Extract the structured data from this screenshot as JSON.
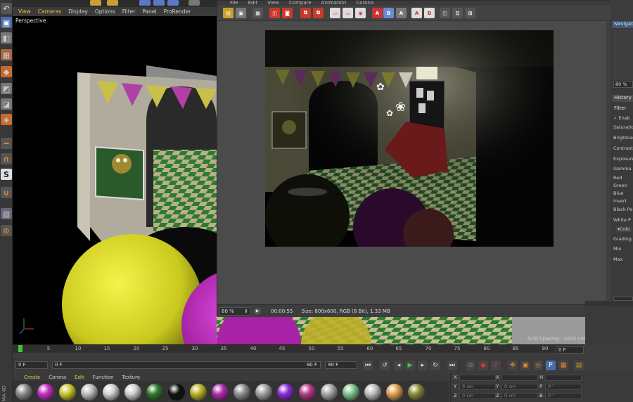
{
  "viewport": {
    "menu": [
      "View",
      "Cameras",
      "Display",
      "Options",
      "Filter",
      "Panel",
      "ProRender"
    ],
    "camera_label": "Perspective",
    "grid_spacing": "Grid Spacing : 1000 cm"
  },
  "picture_viewer": {
    "menu": [
      "File",
      "Edit",
      "View",
      "Compare",
      "Animation",
      "Corona"
    ],
    "zoom": "80 %",
    "render_time": "00:00:55",
    "image_info": "Size: 800x600, RGB (8 Bit), 1.33 MB"
  },
  "right_panel": {
    "navigator_tab": "Navigator",
    "zoom_value": "80 %",
    "history_tab": "History",
    "filter_tab": "Filter",
    "enable_label": "Enab",
    "rows": [
      "Saturation",
      "Brightne",
      "Contrast",
      "Exposure",
      "Gamma",
      "Red",
      "Green",
      "Blue",
      "Invert",
      "Black Po",
      "White P"
    ],
    "color_section": "Colo",
    "bottom_rows": [
      "Grading",
      "Min",
      "Max"
    ]
  },
  "timeline": {
    "ticks": [
      "0",
      "5",
      "10",
      "15",
      "20",
      "25",
      "30",
      "35",
      "40",
      "45",
      "50",
      "55",
      "60",
      "65",
      "70",
      "75",
      "80",
      "85",
      "90"
    ],
    "current_frame": "0 F"
  },
  "controls": {
    "start_field": "0 F",
    "range_start": "0 F",
    "range_end": "90 F",
    "end_field": "90 F"
  },
  "materials": {
    "menu": [
      "Create",
      "Corona",
      "Edit",
      "Function",
      "Texture"
    ],
    "swatches": [
      "#8a8a8a",
      "#c22ec2",
      "#c8c82a",
      "#bdbdbd",
      "#d0d0d0",
      "#cfcfcf",
      "#2e7a2e",
      "#111111",
      "#bcb22a",
      "#b02cae",
      "#8e8e8e",
      "#a0a0a0",
      "#8a2cd8",
      "#b53a8a",
      "#a6a6a6",
      "#7ac68a",
      "#bdbdbd",
      "#e0a050",
      "#8a8a3a"
    ]
  },
  "coordinates": {
    "x_label": "X",
    "y_label": "Y",
    "z_label": "Z",
    "x2_label": "X",
    "y2_label": "Y",
    "z2_label": "Z",
    "h_label": "H",
    "p_label": "P",
    "b_label": "B",
    "x_value": "0 cm",
    "y_value": "0 cm",
    "x2_value": "0 cm",
    "y2_value": "0 cm",
    "h_value": "0 °",
    "p_value": "0 °"
  },
  "brand": "MA 4D"
}
